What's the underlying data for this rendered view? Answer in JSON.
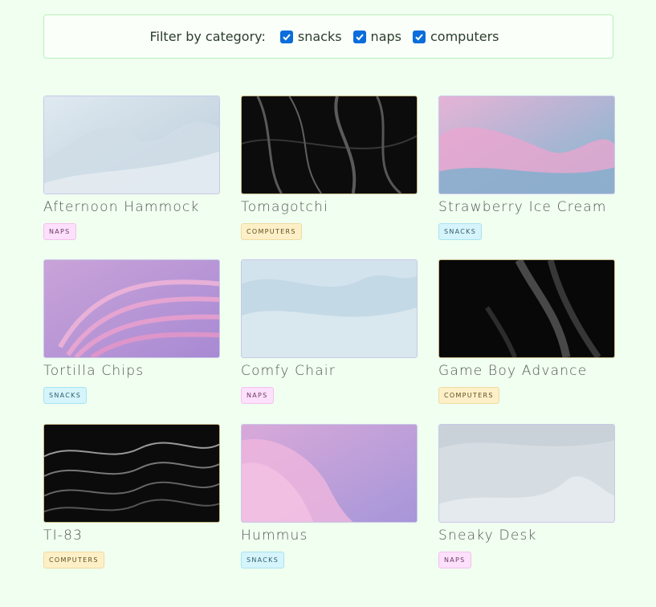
{
  "filter": {
    "label": "Filter by category:",
    "options": [
      {
        "label": "snacks",
        "checked": true
      },
      {
        "label": "naps",
        "checked": true
      },
      {
        "label": "computers",
        "checked": true
      }
    ]
  },
  "cards": [
    {
      "title": "Afternoon Hammock",
      "category": "naps"
    },
    {
      "title": "Tomagotchi",
      "category": "computers"
    },
    {
      "title": "Strawberry Ice Cream",
      "category": "snacks"
    },
    {
      "title": "Tortilla Chips",
      "category": "snacks"
    },
    {
      "title": "Comfy Chair",
      "category": "naps"
    },
    {
      "title": "Game Boy Advance",
      "category": "computers"
    },
    {
      "title": "TI-83",
      "category": "computers"
    },
    {
      "title": "Hummus",
      "category": "snacks"
    },
    {
      "title": "Sneaky Desk",
      "category": "naps"
    }
  ],
  "colors": {
    "page_background": "#f0fff0",
    "checkbox_checked": "#0a6ddb",
    "naps_badge": "#fde0fb",
    "computers_badge": "#fdf0c8",
    "snacks_badge": "#d6f4fb"
  }
}
